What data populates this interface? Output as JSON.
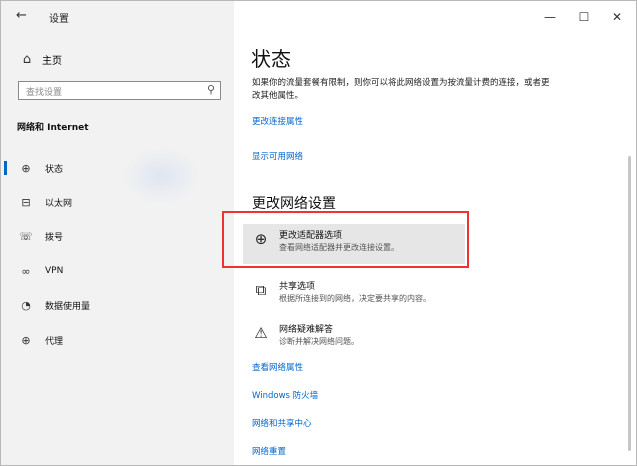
{
  "titlebar": {
    "back_icon": "←",
    "title": "设置",
    "minimize": "—",
    "maximize": "☐",
    "close": "✕"
  },
  "sidebar": {
    "home_label": "主页",
    "search_placeholder": "查找设置",
    "section_title": "网络和 Internet",
    "items": [
      {
        "label": "状态",
        "icon": "globe-status-icon",
        "glyph": "⊕",
        "active": true
      },
      {
        "label": "以太网",
        "icon": "ethernet-icon",
        "glyph": "⊟",
        "active": false
      },
      {
        "label": "拨号",
        "icon": "dialup-icon",
        "glyph": "☏",
        "active": false
      },
      {
        "label": "VPN",
        "icon": "vpn-icon",
        "glyph": "∞",
        "active": false
      },
      {
        "label": "数据使用量",
        "icon": "data-usage-icon",
        "glyph": "◔",
        "active": false
      },
      {
        "label": "代理",
        "icon": "proxy-icon",
        "glyph": "⊕",
        "active": false
      }
    ]
  },
  "main": {
    "title": "状态",
    "description": "如果你的流量套餐有限制，则你可以将此网络设置为按流量计费的连接，或者更改其他属性。",
    "link_change_props": "更改连接属性",
    "link_show_networks": "显示可用网络",
    "section_title": "更改网络设置",
    "options": [
      {
        "title": "更改适配器选项",
        "subtitle": "查看网络适配器并更改连接设置。",
        "icon": "adapter-globe-icon",
        "glyph": "⊕"
      },
      {
        "title": "共享选项",
        "subtitle": "根据所连接到的网络，决定要共享的内容。",
        "icon": "sharing-icon",
        "glyph": "⧉"
      },
      {
        "title": "网络疑难解答",
        "subtitle": "诊断并解决网络问题。",
        "icon": "warning-icon",
        "glyph": "⚠"
      }
    ],
    "links": [
      "查看网络属性",
      "Windows 防火墙",
      "网络和共享中心",
      "网络重置"
    ]
  },
  "colors": {
    "accent": "#0067c0",
    "link": "#0066cc",
    "highlight_box": "#ee3333"
  }
}
